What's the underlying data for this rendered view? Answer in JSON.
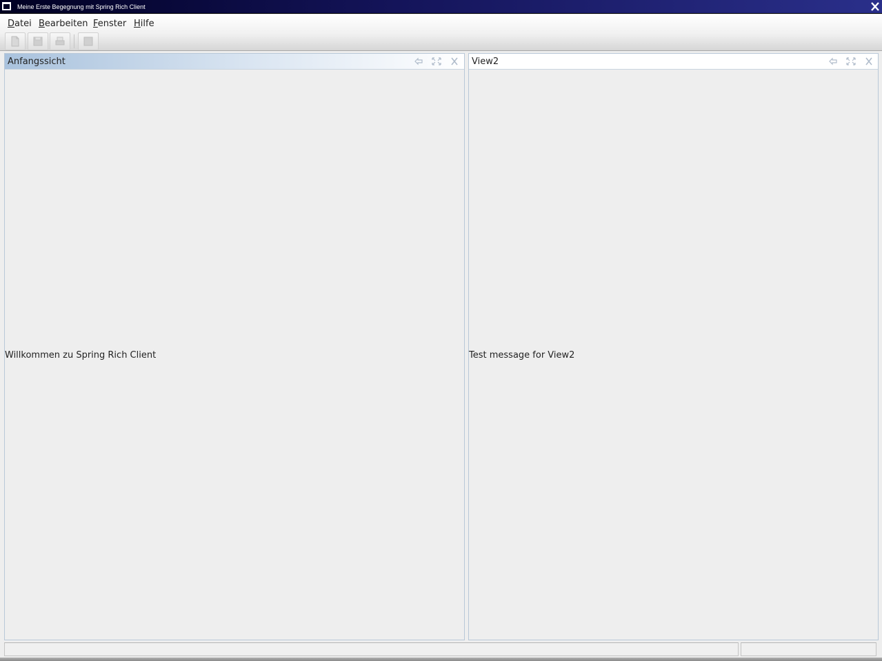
{
  "window": {
    "title": "Meine Erste Begegnung mit Spring Rich Client"
  },
  "menubar": {
    "items": [
      {
        "label": "Datei"
      },
      {
        "label": "Bearbeiten"
      },
      {
        "label": "Fenster"
      },
      {
        "label": "Hilfe"
      }
    ]
  },
  "toolbar": {
    "buttons": [
      {
        "icon": "new-document-icon"
      },
      {
        "icon": "save-icon"
      },
      {
        "icon": "print-icon"
      },
      {
        "icon": "properties-icon"
      }
    ]
  },
  "views": {
    "left": {
      "title": "Anfangssicht",
      "message": "Willkommen zu Spring Rich Client",
      "header_icons": [
        "pin-icon",
        "maximize-icon",
        "close-icon"
      ]
    },
    "right": {
      "title": "View2",
      "message": "Test message for View2",
      "header_icons": [
        "pin-icon",
        "maximize-icon",
        "close-icon"
      ]
    }
  },
  "statusbar": {
    "message": "",
    "progress": ""
  },
  "colors": {
    "titlebar": "#14145a",
    "active_header": "#a9c2dd",
    "background": "#eeeeee"
  }
}
